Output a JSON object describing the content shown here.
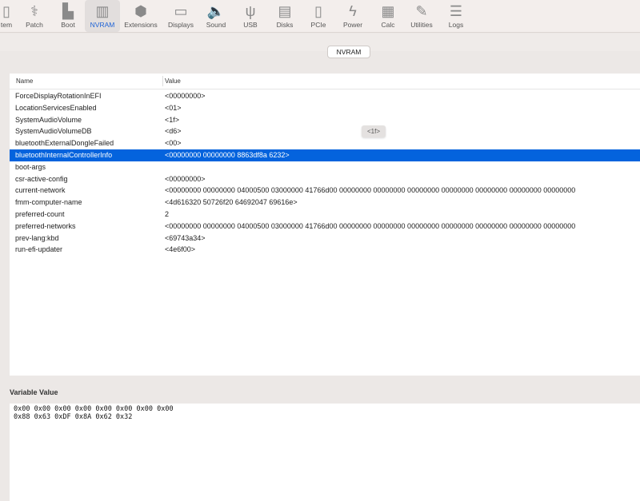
{
  "toolbar": {
    "items": [
      {
        "label": "tem",
        "icon": "system-icon",
        "glyph": "▯"
      },
      {
        "label": "Patch",
        "icon": "bandage-icon",
        "glyph": "⚕"
      },
      {
        "label": "Boot",
        "icon": "boot-icon",
        "glyph": "▙"
      },
      {
        "label": "NVRAM",
        "icon": "nvram-chip-icon",
        "glyph": "▥",
        "active": true
      },
      {
        "label": "Extensions",
        "icon": "extensions-icon",
        "glyph": "⬢"
      },
      {
        "label": "Displays",
        "icon": "display-icon",
        "glyph": "▭"
      },
      {
        "label": "Sound",
        "icon": "speaker-icon",
        "glyph": "🔈"
      },
      {
        "label": "USB",
        "icon": "usb-icon",
        "glyph": "ψ"
      },
      {
        "label": "Disks",
        "icon": "disk-icon",
        "glyph": "▤"
      },
      {
        "label": "PCIe",
        "icon": "pcie-card-icon",
        "glyph": "▯"
      },
      {
        "label": "Power",
        "icon": "power-bolt-icon",
        "glyph": "ϟ"
      },
      {
        "label": "Calc",
        "icon": "calculator-icon",
        "glyph": "▦"
      },
      {
        "label": "Utilities",
        "icon": "wrench-icon",
        "glyph": "✎"
      },
      {
        "label": "Logs",
        "icon": "logs-icon",
        "glyph": "☰"
      }
    ]
  },
  "section_button": "NVRAM",
  "table": {
    "columns": [
      "Name",
      "Value"
    ],
    "selected_index": 5,
    "rows": [
      {
        "name": "ForceDisplayRotationInEFI",
        "value": "<00000000>"
      },
      {
        "name": "LocationServicesEnabled",
        "value": "<01>"
      },
      {
        "name": "SystemAudioVolume",
        "value": "<1f>"
      },
      {
        "name": "SystemAudioVolumeDB",
        "value": "<d6>"
      },
      {
        "name": "bluetoothExternalDongleFailed",
        "value": "<00>"
      },
      {
        "name": "bluetoothInternalControllerInfo",
        "value": "<00000000 00000000 8863df8a 6232>"
      },
      {
        "name": "boot-args",
        "value": ""
      },
      {
        "name": "csr-active-config",
        "value": "<00000000>"
      },
      {
        "name": "current-network",
        "value": "<00000000 00000000 04000500 03000000 41766d00 00000000 00000000 00000000 00000000 00000000 00000000 00000000"
      },
      {
        "name": "fmm-computer-name",
        "value": "<4d616320 50726f20 64692047 69616e>"
      },
      {
        "name": "preferred-count",
        "value": "2"
      },
      {
        "name": "preferred-networks",
        "value": "<00000000 00000000 04000500 03000000 41766d00 00000000 00000000 00000000 00000000 00000000 00000000 00000000"
      },
      {
        "name": "prev-lang:kbd",
        "value": "<69743a34>"
      },
      {
        "name": "run-efi-updater",
        "value": "<4e6f00>"
      }
    ]
  },
  "tooltip": "<1f>",
  "variable_value": {
    "label": "Variable Value",
    "lines": [
      "0x00 0x00 0x00 0x00 0x00 0x00 0x00 0x00",
      "0x88 0x63 0xDF 0x8A 0x62 0x32"
    ]
  }
}
